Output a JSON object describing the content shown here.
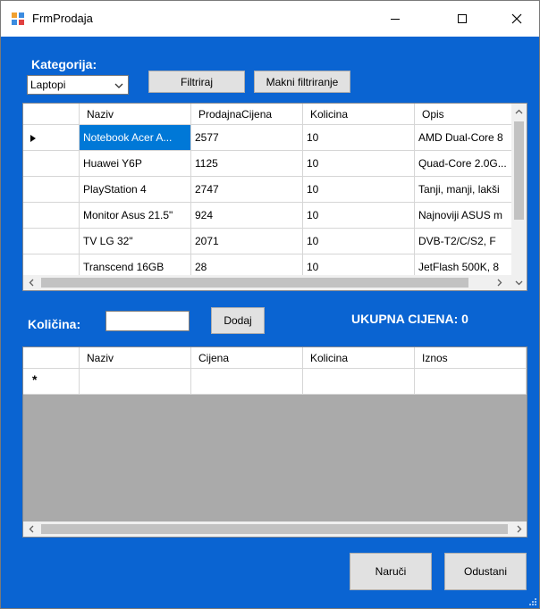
{
  "window": {
    "title": "FrmProdaja"
  },
  "filter": {
    "label": "Kategorija:",
    "selected": "Laptopi",
    "filter_button": "Filtriraj",
    "clear_button": "Makni filtriranje"
  },
  "products": {
    "columns": [
      "Naziv",
      "ProdajnaCijena",
      "Kolicina",
      "Opis"
    ],
    "rows": [
      [
        "Notebook Acer A...",
        "2577",
        "10",
        "AMD Dual-Core 8"
      ],
      [
        "Huawei Y6P",
        "1125",
        "10",
        "Quad-Core 2.0G..."
      ],
      [
        "PlayStation 4",
        "2747",
        "10",
        "Tanji, manji, lakši"
      ],
      [
        "Monitor Asus 21.5\"",
        "924",
        "10",
        "Najnoviji ASUS m"
      ],
      [
        "TV LG 32\"",
        "2071",
        "10",
        "DVB-T2/C/S2, F"
      ],
      [
        "Transcend 16GB",
        "28",
        "10",
        "JetFlash 500K, 8"
      ]
    ]
  },
  "quantity": {
    "label": "Količina:",
    "value": "",
    "add_button": "Dodaj"
  },
  "total": {
    "text": "UKUPNA CIJENA: 0"
  },
  "cart": {
    "columns": [
      "Naziv",
      "Cijena",
      "Kolicina",
      "Iznos"
    ],
    "new_row_marker": "*"
  },
  "actions": {
    "order_button": "Naruči",
    "cancel_button": "Odustani"
  },
  "colors": {
    "background": "#0a64d2",
    "selection": "#0078d7",
    "empty_grid": "#aaaaaa"
  }
}
